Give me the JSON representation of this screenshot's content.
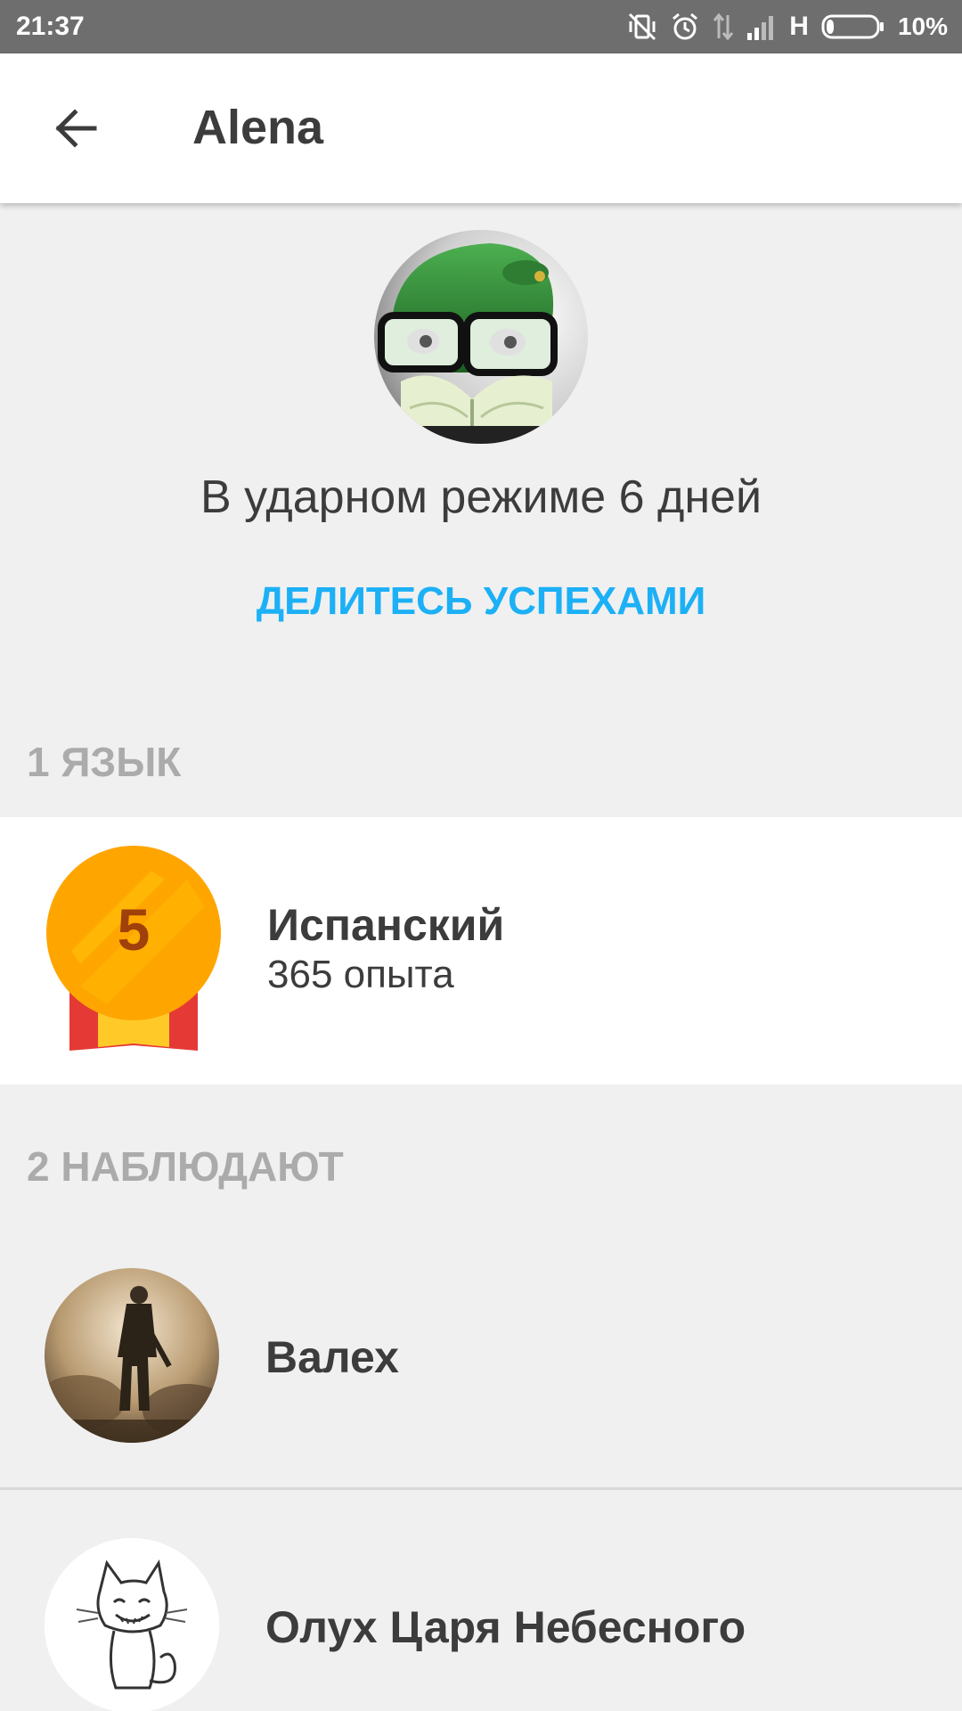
{
  "status_bar": {
    "time": "21:37",
    "network": "H",
    "battery": "10%",
    "icons": [
      "vibrate-off-icon",
      "alarm-icon",
      "data-arrows-icon",
      "signal-icon",
      "battery-icon"
    ]
  },
  "app_bar": {
    "back_icon": "arrow-back-icon",
    "title": "Alena"
  },
  "profile": {
    "avatar": "owl-with-glasses-avatar",
    "streak_text": "В ударном режиме 6 дней",
    "share_label": "ДЕЛИТЕСЬ УСПЕХАМИ"
  },
  "languages": {
    "header": "1 ЯЗЫК",
    "items": [
      {
        "level": "5",
        "name": "Испанский",
        "xp": "365 опыта"
      }
    ]
  },
  "followers": {
    "header": "2 НАБЛЮДАЮТ",
    "items": [
      {
        "name": "Валех",
        "avatar": "soldier-avatar"
      },
      {
        "name": "Олух Царя Небесного",
        "avatar": "cat-sketch-avatar"
      }
    ]
  },
  "colors": {
    "accent": "#1cb0f6",
    "status_bar": "#6e6e6e",
    "text": "#3c3c3c",
    "section_header": "#ababab",
    "medal_gold": "#ffa500",
    "medal_ribbon_red": "#e53935"
  }
}
